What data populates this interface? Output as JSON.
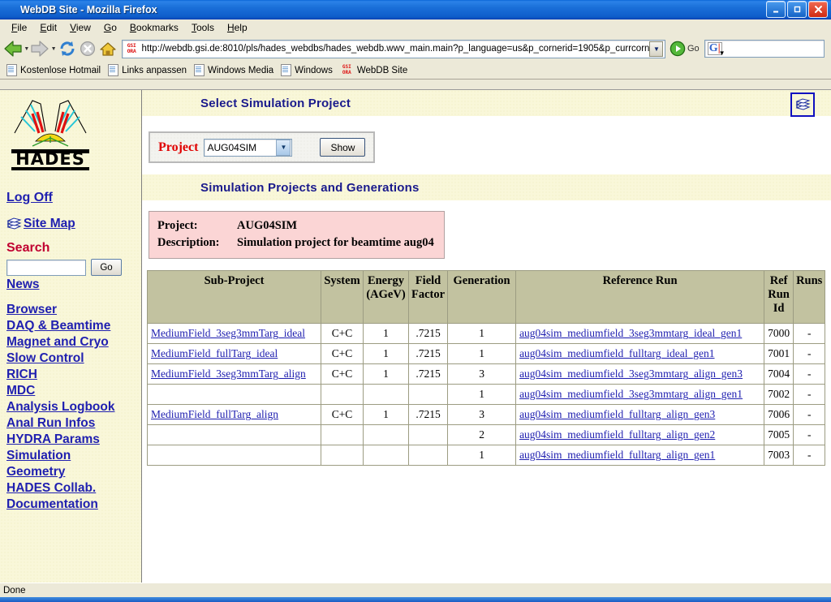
{
  "window": {
    "title": "WebDB Site - Mozilla Firefox",
    "icon": "firefox-icon",
    "minimize_label": "Minimize",
    "maximize_label": "Maximize",
    "close_label": "Close"
  },
  "menubar": {
    "items": [
      {
        "label": "File",
        "accel": "F"
      },
      {
        "label": "Edit",
        "accel": "E"
      },
      {
        "label": "View",
        "accel": "V"
      },
      {
        "label": "Go",
        "accel": "G"
      },
      {
        "label": "Bookmarks",
        "accel": "B"
      },
      {
        "label": "Tools",
        "accel": "T"
      },
      {
        "label": "Help",
        "accel": "H"
      }
    ]
  },
  "toolbar": {
    "back": "Back",
    "forward": "Forward",
    "reload": "Reload",
    "stop": "Stop",
    "home": "Home",
    "url": "http://webdb.gsi.de:8010/pls/hades_webdbs/hades_webdb.wwv_main.main?p_language=us&p_cornerid=1905&p_currcorn",
    "url_badge_top": "GSI",
    "url_badge_bottom": "ORA",
    "go_label": "Go",
    "search_placeholder": "",
    "search_value": ""
  },
  "bookmarks": [
    {
      "label": "Kostenlose Hotmail",
      "icon": "page-icon"
    },
    {
      "label": "Links anpassen",
      "icon": "page-icon"
    },
    {
      "label": "Windows Media",
      "icon": "page-icon"
    },
    {
      "label": "Windows",
      "icon": "page-icon"
    },
    {
      "label": "WebDB Site",
      "icon": "gsi-ora-icon"
    }
  ],
  "sidebar": {
    "logo_alt": "HADES",
    "logo_text": "HADES",
    "logoff": "Log Off",
    "sitemap": "Site Map",
    "search_title": "Search",
    "search_value": "",
    "search_placeholder": "",
    "go_label": "Go",
    "news": "News",
    "links": [
      "Browser",
      "DAQ & Beamtime",
      "Magnet and Cryo",
      "Slow Control",
      "RICH",
      "MDC",
      "Analysis Logbook",
      "Anal Run Infos",
      "HYDRA Params",
      "Simulation",
      "Geometry",
      "HADES Collab.",
      "Documentation"
    ]
  },
  "main": {
    "heading1": "Select Simulation Project",
    "heading2": "Simulation Projects and Generations",
    "corner_icon": "site-map-icon",
    "form": {
      "project_label": "Project",
      "project_value": "AUG04SIM",
      "project_options": [
        "AUG04SIM"
      ],
      "show_label": "Show"
    },
    "project_info": {
      "project_label": "Project:",
      "project_value": "AUG04SIM",
      "description_label": "Description:",
      "description_value": "Simulation project for beamtime aug04"
    },
    "table": {
      "headers": [
        "Sub-Project",
        "System",
        "Energy (AGeV)",
        "Field Factor",
        "Generation",
        "Reference Run",
        "Ref Run Id",
        "Runs"
      ],
      "headers_multiline": [
        [
          "Sub-Project"
        ],
        [
          "System"
        ],
        [
          "Energy",
          "(AGeV)"
        ],
        [
          "Field",
          "Factor"
        ],
        [
          "Generation"
        ],
        [
          "Reference Run"
        ],
        [
          "Ref",
          "Run",
          "Id"
        ],
        [
          "Runs"
        ]
      ],
      "rows": [
        {
          "subproject": "MediumField_3seg3mmTarg_ideal",
          "system": "C+C",
          "energy": "1",
          "field_factor": ".7215",
          "generation": "1",
          "reference_run": "aug04sim_mediumfield_3seg3mmtarg_ideal_gen1",
          "ref_run_id": "7000",
          "runs": "-"
        },
        {
          "subproject": "MediumField_fullTarg_ideal",
          "system": "C+C",
          "energy": "1",
          "field_factor": ".7215",
          "generation": "1",
          "reference_run": "aug04sim_mediumfield_fulltarg_ideal_gen1",
          "ref_run_id": "7001",
          "runs": "-"
        },
        {
          "subproject": "MediumField_3seg3mmTarg_align",
          "system": "C+C",
          "energy": "1",
          "field_factor": ".7215",
          "generation": "3",
          "reference_run": "aug04sim_mediumfield_3seg3mmtarg_align_gen3",
          "ref_run_id": "7004",
          "runs": "-"
        },
        {
          "subproject": "",
          "system": "",
          "energy": "",
          "field_factor": "",
          "generation": "1",
          "reference_run": "aug04sim_mediumfield_3seg3mmtarg_align_gen1",
          "ref_run_id": "7002",
          "runs": "-"
        },
        {
          "subproject": "MediumField_fullTarg_align",
          "system": "C+C",
          "energy": "1",
          "field_factor": ".7215",
          "generation": "3",
          "reference_run": "aug04sim_mediumfield_fulltarg_align_gen3",
          "ref_run_id": "7006",
          "runs": "-"
        },
        {
          "subproject": "",
          "system": "",
          "energy": "",
          "field_factor": "",
          "generation": "2",
          "reference_run": "aug04sim_mediumfield_fulltarg_align_gen2",
          "ref_run_id": "7005",
          "runs": "-"
        },
        {
          "subproject": "",
          "system": "",
          "energy": "",
          "field_factor": "",
          "generation": "1",
          "reference_run": "aug04sim_mediumfield_fulltarg_align_gen1",
          "ref_run_id": "7003",
          "runs": "-"
        }
      ]
    }
  },
  "statusbar": {
    "text": "Done"
  },
  "colors": {
    "heading_text": "#1a1a8c",
    "link": "#2020b0",
    "search_title": "#c00030",
    "project_label": "#e00000",
    "band_bg": "#f9f7d9",
    "table_header_bg": "#c2c2a0",
    "project_box_bg": "#fbd5d5",
    "titlebar_bg": "#1a6fd9"
  }
}
